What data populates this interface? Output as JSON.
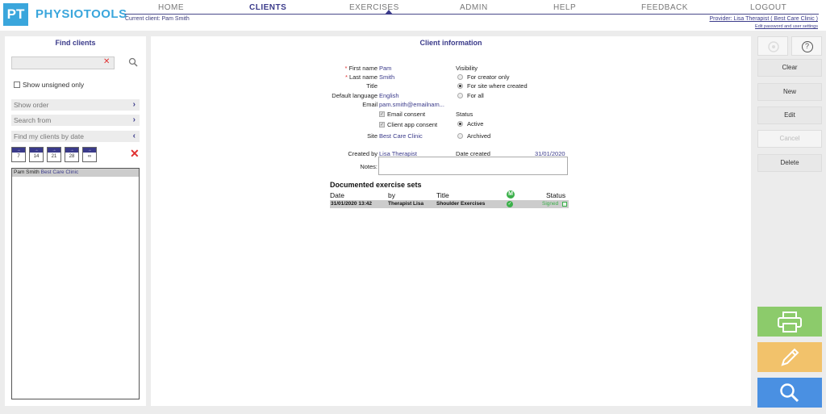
{
  "header": {
    "logo_mark": "PT",
    "logo_text": "PHYSIOTOOLS",
    "current_client": "Current client: Pam Smith",
    "nav": [
      "HOME",
      "CLIENTS",
      "EXERCISES",
      "ADMIN",
      "HELP",
      "FEEDBACK",
      "LOGOUT"
    ],
    "active_nav": "CLIENTS",
    "provider": "Provider: Lisa Therapist ( Best Care Clinic )",
    "edit_password": "Edit password and user settings"
  },
  "left": {
    "title": "Find clients",
    "search_value": "",
    "show_unsigned": "Show unsigned only",
    "show_order": "Show order",
    "search_from": "Search from",
    "find_by_date": "Find my clients by date",
    "date_buttons": [
      "7",
      "14",
      "21",
      "28",
      "∞"
    ],
    "clients": [
      {
        "name": "Pam Smith",
        "clinic": "Best Care Clinic"
      }
    ]
  },
  "main": {
    "title": "Client information",
    "labels": {
      "first_name": "First name",
      "last_name": "Last name",
      "title": "Title",
      "default_language": "Default language",
      "email": "Email",
      "site": "Site",
      "created_by": "Created by",
      "date_created": "Date created",
      "notes": "Notes:"
    },
    "values": {
      "first_name": "Pam",
      "last_name": "Smith",
      "default_language": "English",
      "email": "pam.smith@emailnam...",
      "site": "Best Care Clinic",
      "created_by": "Lisa Therapist",
      "date_created": "31/01/2020"
    },
    "email_consent": "Email consent",
    "client_app_consent": "Client app consent",
    "visibility": {
      "label": "Visibility",
      "options": [
        "For creator only",
        "For site where created",
        "For all"
      ],
      "selected": 1
    },
    "status": {
      "label": "Status",
      "options": [
        "Active",
        "Archived"
      ],
      "selected": 0
    },
    "sets": {
      "title": "Documented exercise sets",
      "headers": {
        "date": "Date",
        "by": "by",
        "title": "Title",
        "m_icon": "M",
        "status": "Status"
      },
      "rows": [
        {
          "date": "31/01/2020 13:42",
          "by": "Therapist Lisa",
          "title": "Shoulder Exercises",
          "status": "Signed"
        }
      ]
    }
  },
  "right": {
    "clear": "Clear",
    "new": "New",
    "edit": "Edit",
    "cancel": "Cancel",
    "delete": "Delete",
    "help_mark": "?"
  },
  "colors": {
    "brand": "#3aa6dc",
    "accent": "#3a3a8a",
    "print": "#8ccb6b",
    "edit": "#f2c26b",
    "search": "#4a90e2"
  }
}
